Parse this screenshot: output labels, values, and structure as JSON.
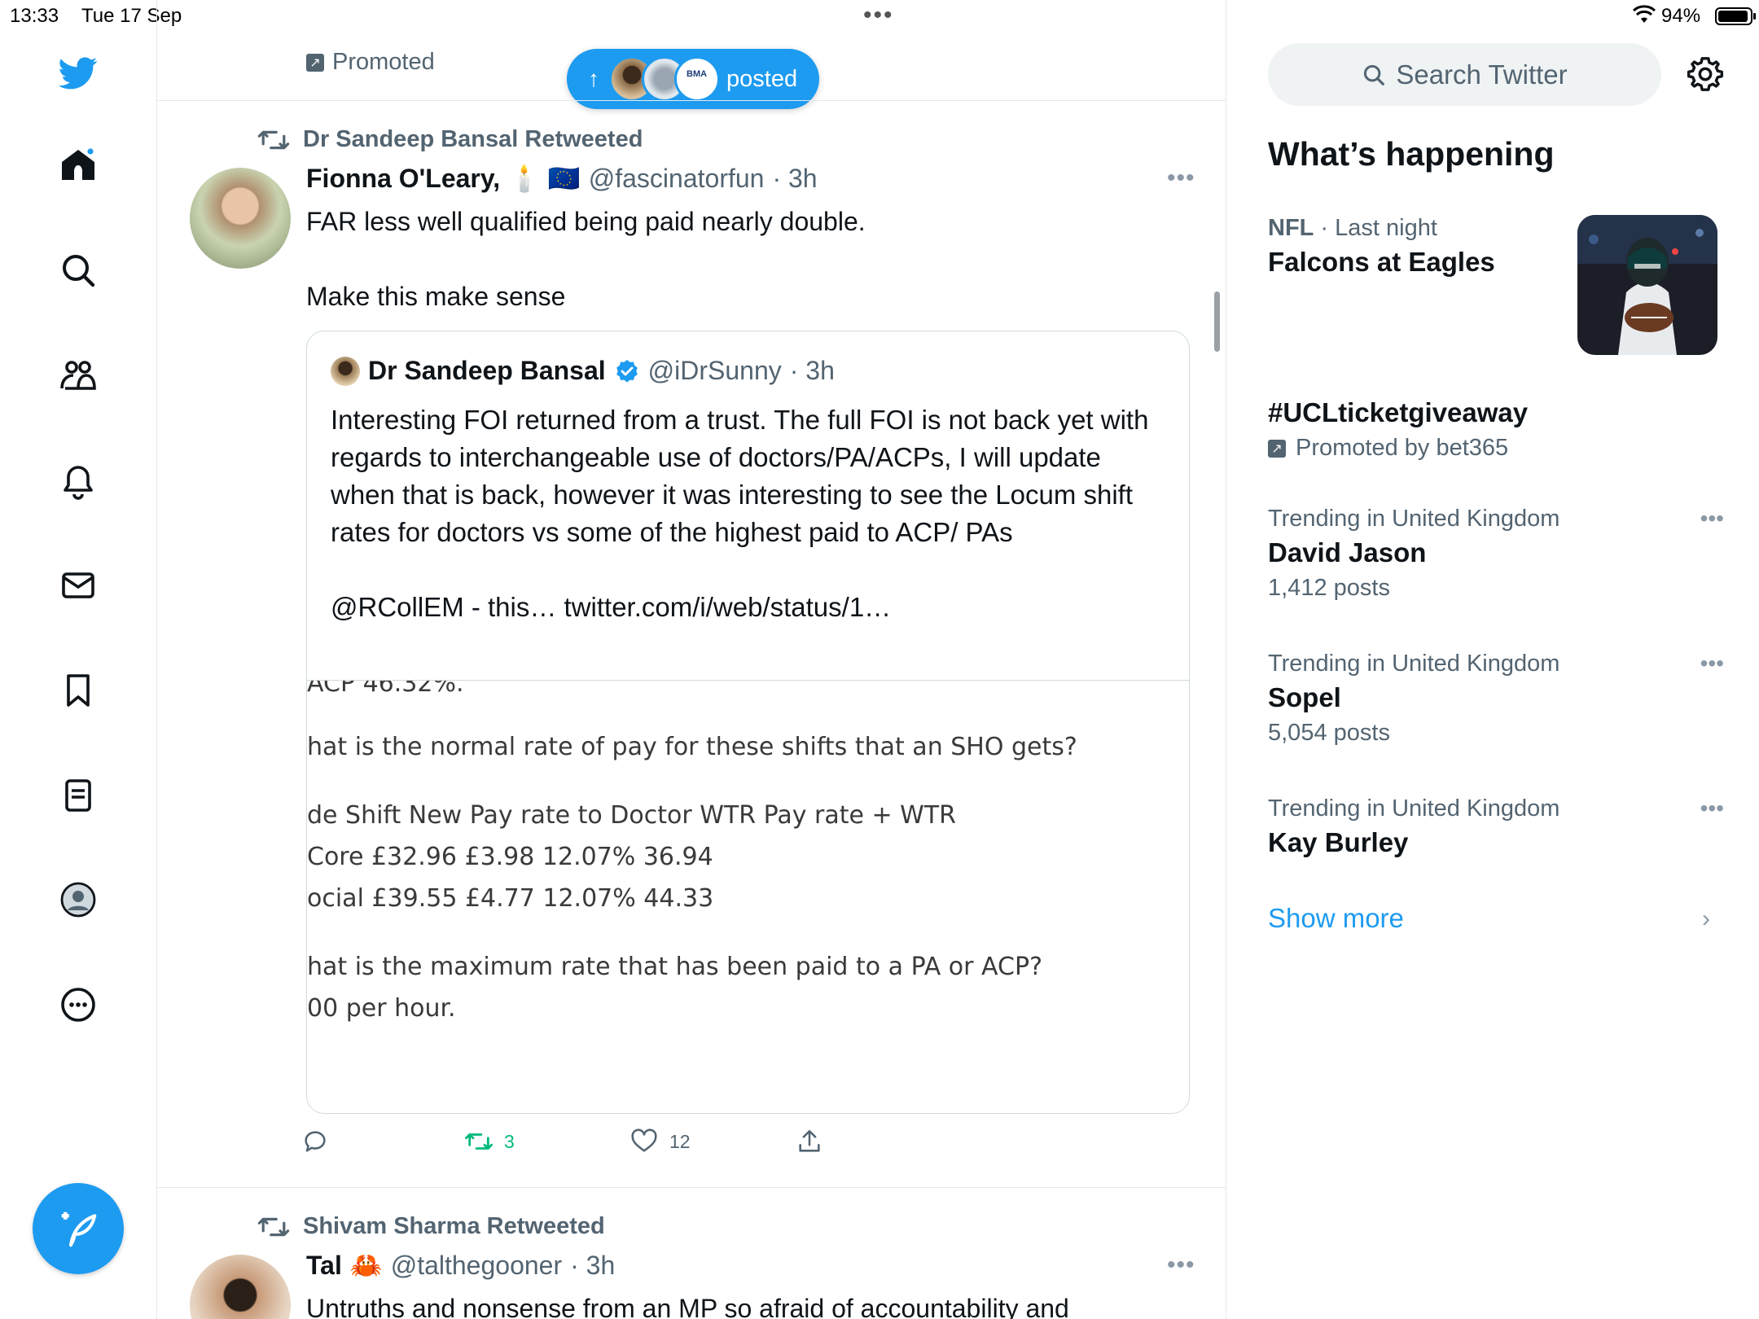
{
  "status_bar": {
    "time": "13:33",
    "date": "Tue 17 Sep",
    "battery": "94%",
    "center_dots": "•••"
  },
  "nav": {
    "items": [
      "bird-logo",
      "home",
      "explore",
      "communities",
      "notifications",
      "messages",
      "bookmarks",
      "lists",
      "profile",
      "more"
    ],
    "accent_color": "#1d9bf0"
  },
  "timeline": {
    "promoted_label": "Promoted",
    "posted_pill": {
      "arrow": "↑",
      "label": "posted"
    },
    "tweet1": {
      "retweeted_by": "Dr Sandeep Bansal Retweeted",
      "name": "Fionna O'Leary,",
      "emoji": "🕯️ 🇪🇺",
      "handle": "@fascinatorfun",
      "time": "· 3h",
      "text": "FAR less well qualified being paid nearly double.\n\nMake this make sense",
      "quote": {
        "name": "Dr Sandeep Bansal",
        "handle": "@iDrSunny",
        "time": "· 3h",
        "text": "Interesting FOI returned from a trust. The full FOI is not back yet with regards to interchangeable use of doctors/PA/ACPs, I will update when that is back, however it was interesting to see the Locum shift rates for doctors vs some of the highest paid to ACP/ PAs\n\n@RCollEM - this… twitter.com/i/web/status/1…",
        "image_lines": [
          "ACP 46.32%.",
          "hat is the normal rate of pay for these shifts that an SHO gets?",
          "de Shift New Pay rate to Doctor WTR Pay rate + WTR",
          "Core £32.96 £3.98 12.07% 36.94",
          "ocial £39.55 £4.77 12.07% 44.33",
          "hat is the maximum rate that has been paid to a PA or ACP?",
          "00 per hour."
        ]
      },
      "actions": {
        "reply": "",
        "retweets": "3",
        "likes": "12",
        "share": ""
      }
    },
    "tweet2": {
      "retweeted_by": "Shivam Sharma Retweeted",
      "name": "Tal",
      "emoji": "🦀",
      "handle": "@talthegooner",
      "time": "· 3h",
      "text": "Untruths and nonsense from an MP so afraid of accountability and"
    }
  },
  "sidebar": {
    "search_placeholder": "Search Twitter",
    "section_title": "What’s happening",
    "trends": [
      {
        "category": "NFL",
        "meta": " · Last night",
        "title": "Falcons at Eagles",
        "count": ""
      },
      {
        "category": "",
        "meta": "",
        "title": "#UCLticketgiveaway",
        "count": "Promoted by bet365"
      },
      {
        "category": "",
        "meta": "Trending in United Kingdom",
        "title": "David Jason",
        "count": "1,412 posts"
      },
      {
        "category": "",
        "meta": "Trending in United Kingdom",
        "title": "Sopel",
        "count": "5,054 posts"
      },
      {
        "category": "",
        "meta": "Trending in United Kingdom",
        "title": "Kay Burley",
        "count": ""
      }
    ],
    "show_more": "Show more"
  }
}
